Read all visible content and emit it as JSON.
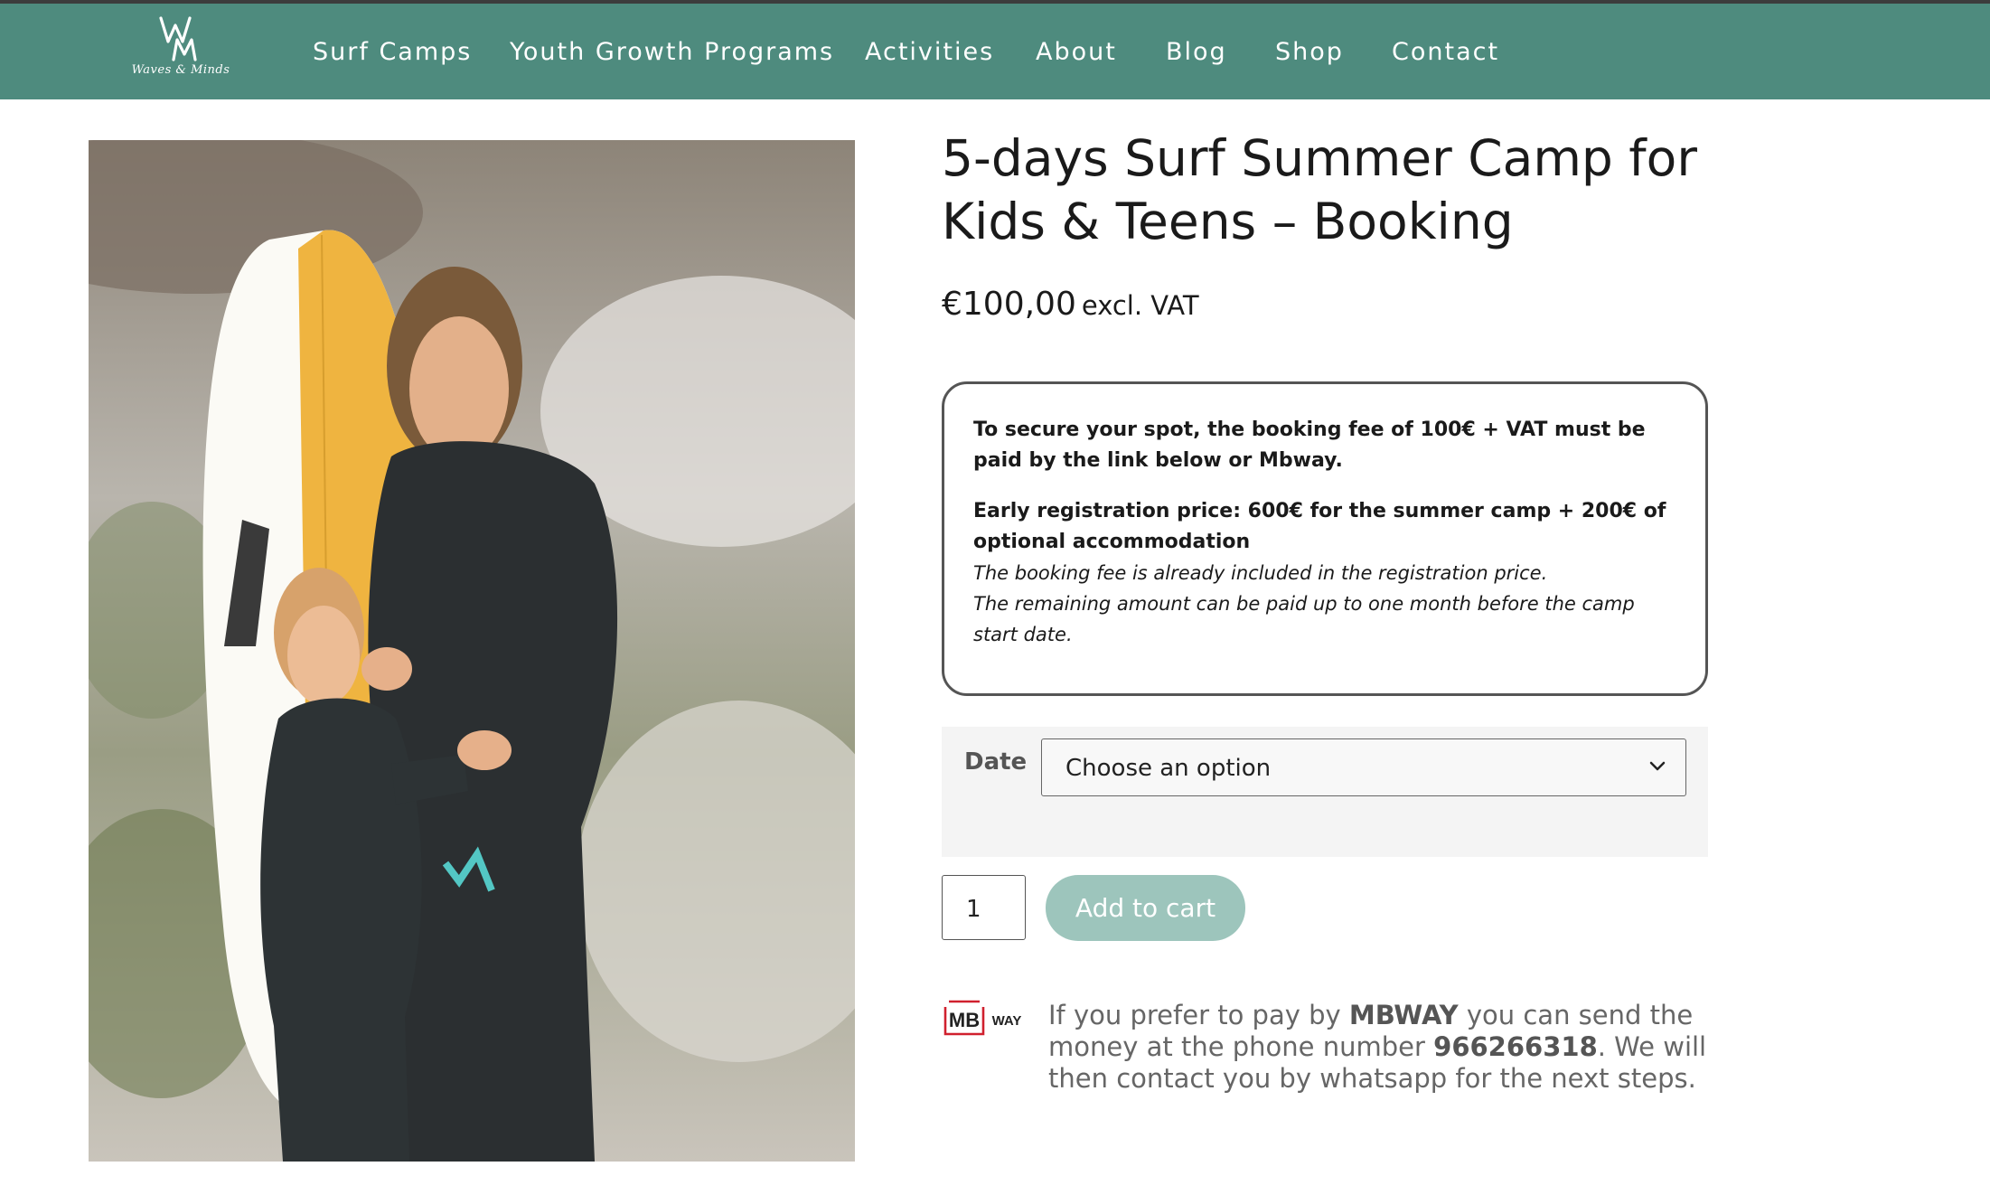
{
  "brand": {
    "logo_caption": "Waves & Minds"
  },
  "nav": {
    "items": [
      "Surf Camps",
      "Youth Growth Programs",
      "Activities",
      "About",
      "Blog",
      "Shop",
      "Contact"
    ]
  },
  "product": {
    "title": "5-days Surf Summer Camp for Kids & Teens – Booking",
    "price": "€100,00",
    "price_suffix": "excl. VAT",
    "info": {
      "line1": "To secure your spot, the booking fee of 100€ + VAT must be paid by the link below or Mbway.",
      "line2": "Early registration price:  600€ for the summer camp + 200€ of optional accommodation",
      "line3": "The booking fee is already included in the registration price.",
      "line4": "The remaining amount can be paid up to one month before the camp start date."
    },
    "variation_label": "Date",
    "variation_value": "Choose an option",
    "quantity": "1",
    "add_to_cart": "Add to cart"
  },
  "mbway": {
    "logo_mb": "MB",
    "logo_way": "WAY",
    "text_1": "If you prefer to pay by ",
    "bold_1": "MBWAY",
    "text_2": " you can send the money at the phone number ",
    "bold_2": "966266318",
    "text_3": ". We will then contact you by whatsapp for the next steps."
  },
  "colors": {
    "nav_bg": "#4e8b7e",
    "button_bg": "#9dc5bc",
    "mbway_red": "#d0202e"
  }
}
